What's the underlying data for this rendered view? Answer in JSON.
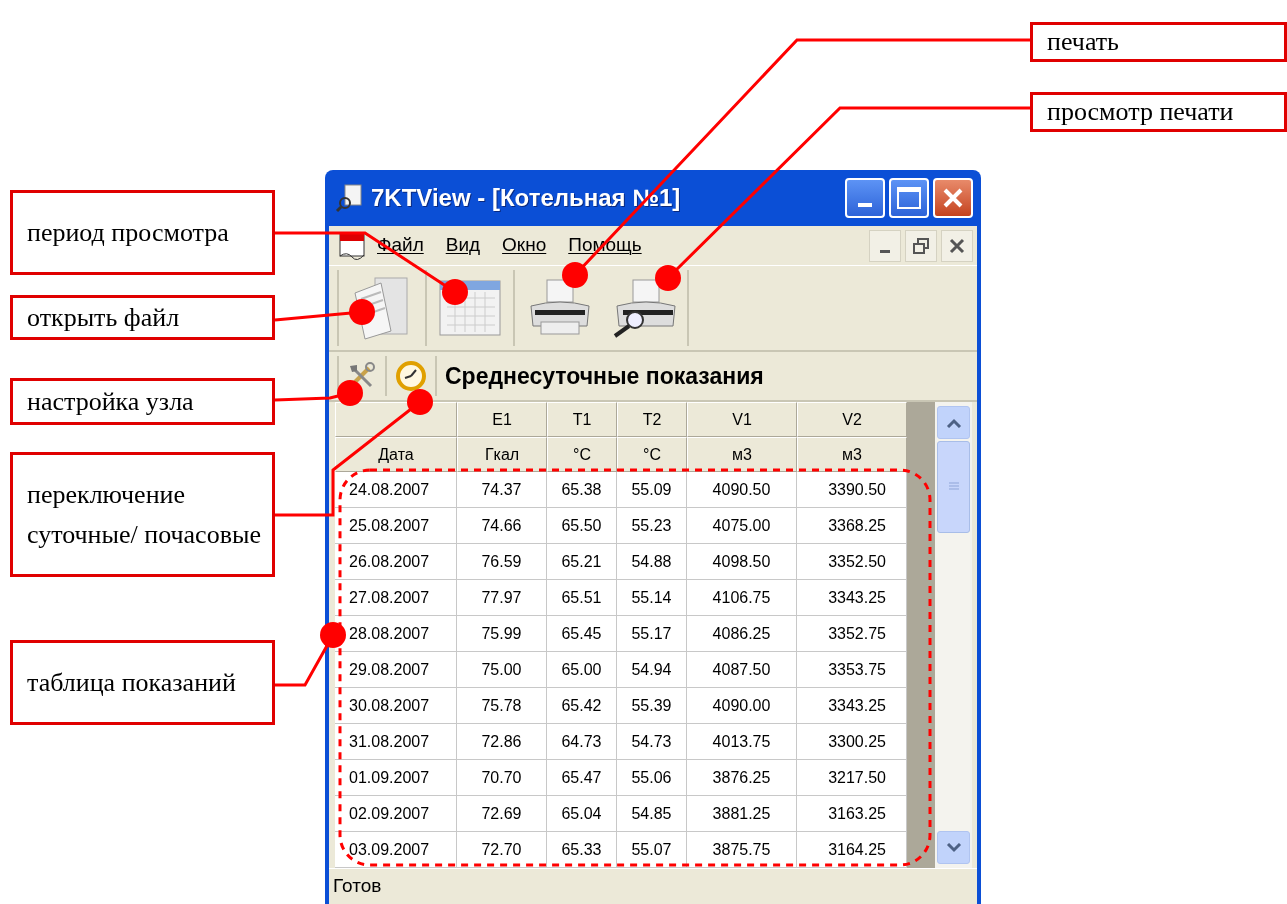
{
  "callouts": [
    {
      "text": "печать",
      "kind": "print"
    },
    {
      "text": "просмотр печати",
      "kind": "preview"
    },
    {
      "text": "период просмотра",
      "kind": "period"
    },
    {
      "text": "открыть файл",
      "kind": "open"
    },
    {
      "text": "настройка узла",
      "kind": "settings"
    },
    {
      "text": "переключение суточные/ почасовые",
      "kind": "toggle"
    },
    {
      "text": "таблица показаний",
      "kind": "table"
    }
  ],
  "window": {
    "title": "7KTView - [Котельная №1]"
  },
  "menu": [
    "Файл",
    "Вид",
    "Окно",
    "Помощь"
  ],
  "panel_title": "Среднесуточные показания",
  "table": {
    "columns": [
      {
        "unit": "Дата"
      },
      {
        "name": "E1",
        "unit": "Гкал"
      },
      {
        "name": "T1",
        "unit": "°C"
      },
      {
        "name": "T2",
        "unit": "°C"
      },
      {
        "name": "V1",
        "unit": "м3"
      },
      {
        "name": "V2",
        "unit": "м3"
      }
    ],
    "rows": [
      [
        "24.08.2007",
        "74.37",
        "65.38",
        "55.09",
        "4090.50",
        "3390.50"
      ],
      [
        "25.08.2007",
        "74.66",
        "65.50",
        "55.23",
        "4075.00",
        "3368.25"
      ],
      [
        "26.08.2007",
        "76.59",
        "65.21",
        "54.88",
        "4098.50",
        "3352.50"
      ],
      [
        "27.08.2007",
        "77.97",
        "65.51",
        "55.14",
        "4106.75",
        "3343.25"
      ],
      [
        "28.08.2007",
        "75.99",
        "65.45",
        "55.17",
        "4086.25",
        "3352.75"
      ],
      [
        "29.08.2007",
        "75.00",
        "65.00",
        "54.94",
        "4087.50",
        "3353.75"
      ],
      [
        "30.08.2007",
        "75.78",
        "65.42",
        "55.39",
        "4090.00",
        "3343.25"
      ],
      [
        "31.08.2007",
        "72.86",
        "64.73",
        "54.73",
        "4013.75",
        "3300.25"
      ],
      [
        "01.09.2007",
        "70.70",
        "65.47",
        "55.06",
        "3876.25",
        "3217.50"
      ],
      [
        "02.09.2007",
        "72.69",
        "65.04",
        "54.85",
        "3881.25",
        "3163.25"
      ],
      [
        "03.09.2007",
        "72.70",
        "65.33",
        "55.07",
        "3875.75",
        "3164.25"
      ]
    ]
  },
  "status_bar": "Готов"
}
